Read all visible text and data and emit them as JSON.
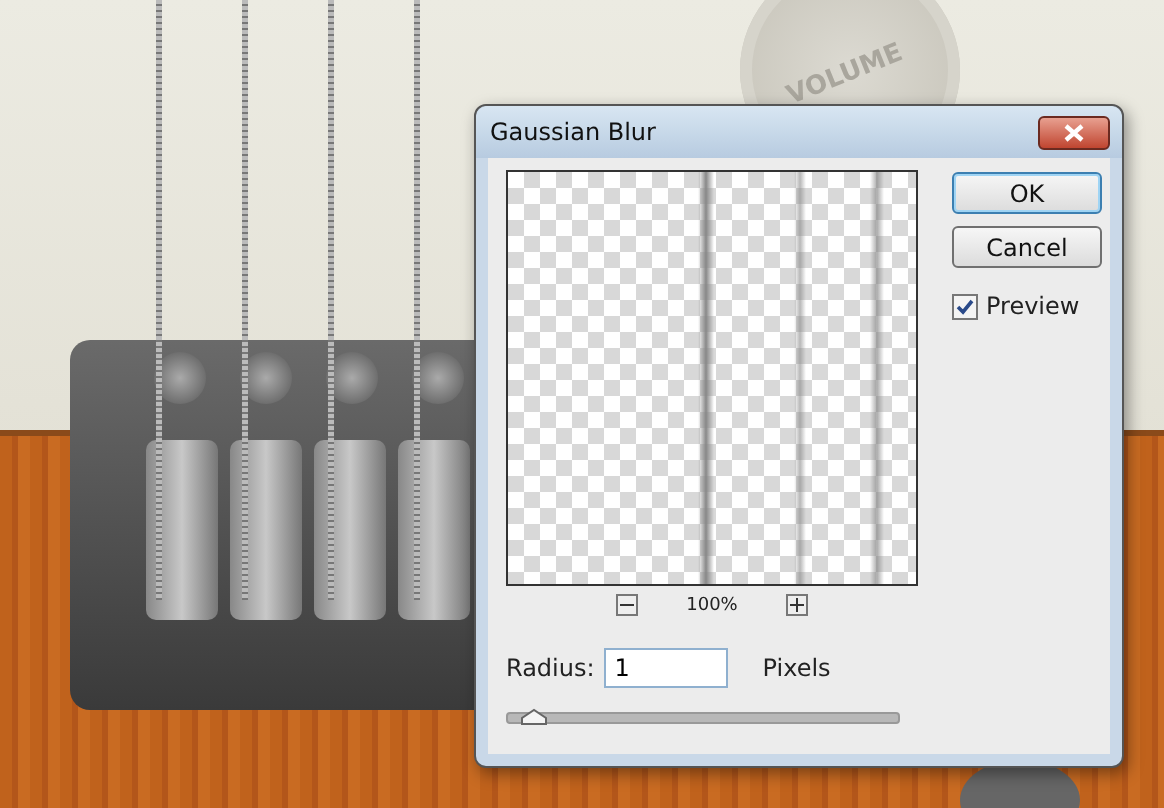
{
  "artwork": {
    "knob_label": "VOLUME"
  },
  "dialog": {
    "title": "Gaussian Blur",
    "preview": {
      "zoom": "100%"
    },
    "buttons": [
      "OK",
      "Cancel"
    ],
    "preview_checkbox": {
      "label": "Preview",
      "checked": true
    },
    "radius": {
      "label": "Radius:",
      "value": "1",
      "unit": "Pixels"
    },
    "slider": {
      "level": 0.02
    }
  }
}
